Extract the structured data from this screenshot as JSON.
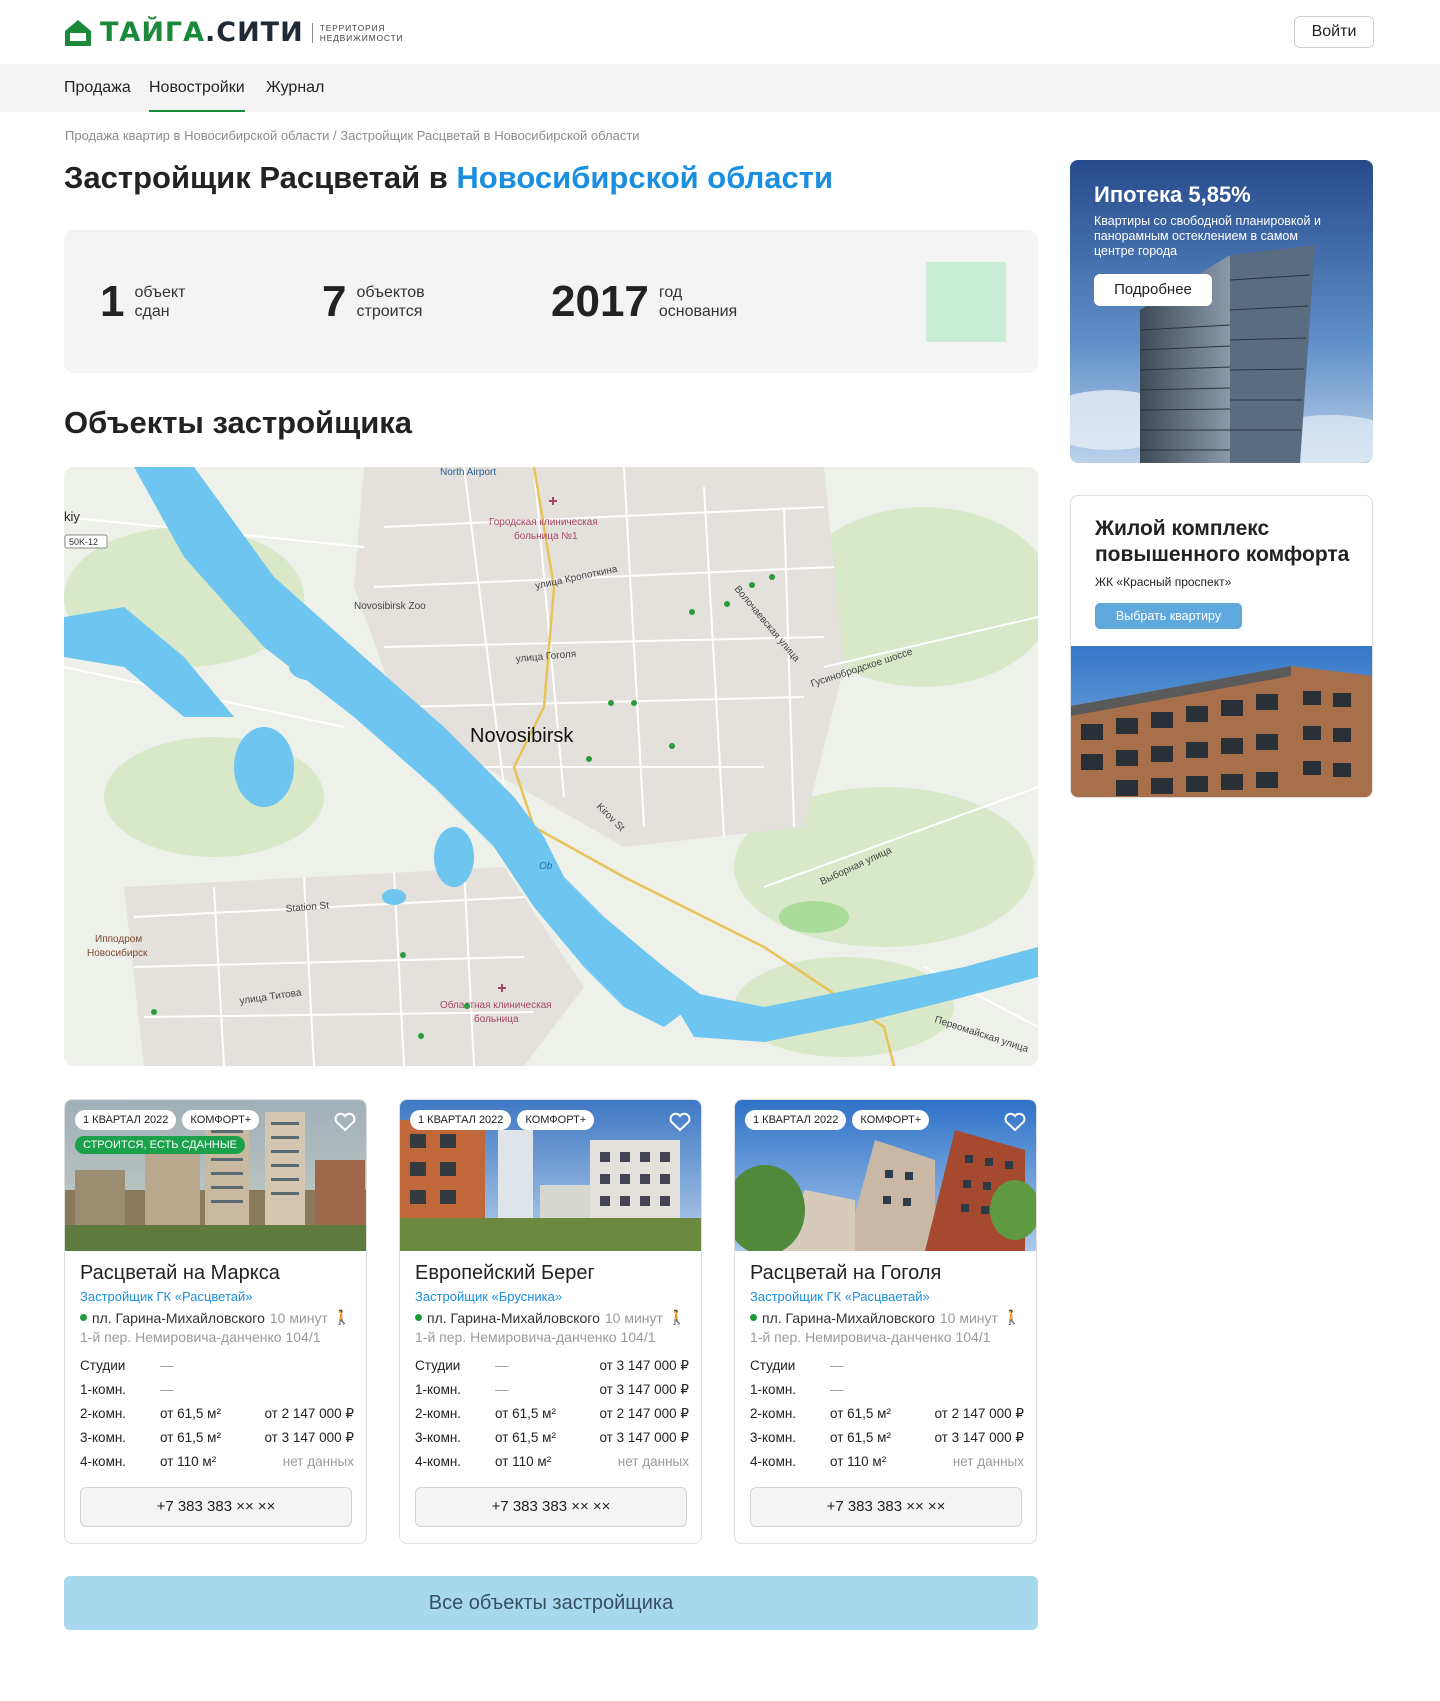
{
  "header": {
    "logo_primary": "ТАЙГА",
    "logo_secondary": ".СИТИ",
    "logo_tag_line1": "ТЕРРИТОРИЯ",
    "logo_tag_line2": "НЕДВИЖИМОСТИ",
    "login_label": "Войти"
  },
  "nav": {
    "items": [
      {
        "label": "Продажа"
      },
      {
        "label": "Новостройки",
        "active": true
      },
      {
        "label": "Журнал"
      }
    ]
  },
  "breadcrumb": "Продажа квартир в Новосибирской области / Застройщик Расцветай в Новосибирской области",
  "title": {
    "main": "Застройщик Расцветай в ",
    "accent": "Новосибирской области"
  },
  "stats": [
    {
      "number": "1",
      "line1": "объект",
      "line2": "сдан"
    },
    {
      "number": "7",
      "line1": "объектов",
      "line2": "строится"
    },
    {
      "number": "2017",
      "line1": "год",
      "line2": "основания"
    }
  ],
  "section_title": "Объекты застройщика",
  "map": {
    "labels": {
      "north_airport": "North Airport",
      "hospital1_line1": "Городская клиническая",
      "hospital1_line2": "больница №1",
      "kropotkina": "улица Кропоткина",
      "zoo": "Novosibirsk Zoo",
      "volochaevskaya": "Волочаевская улица",
      "gogolya": "улица Гоголя",
      "gusinobrodskoe": "Гусинобродское шоссе",
      "city": "Novosibirsk",
      "kirov": "Kirov St",
      "ob": "Ob",
      "vybornaya": "Выборная улица",
      "station": "Station St",
      "hippodrome_line1": "Ипподром",
      "hippodrome_line2": "Новосибирск",
      "titova": "улица Титова",
      "hospital2_line1": "Областная клиническая",
      "hospital2_line2": "больница",
      "pervomayskaya": "Первомайская улица",
      "kiy": "kiy",
      "road_shield": "50K-12"
    }
  },
  "cards": [
    {
      "chips": [
        "1 КВАРТАЛ 2022",
        "КОМФОРТ+"
      ],
      "status": "СТРОИТСЯ, ЕСТЬ СДАННЫЕ",
      "title": "Расцветай на Маркса",
      "developer": "Застройщик ГК «Расцветай»",
      "metro": "пл. Гарина-Михайловского",
      "metro_time": "10 минут",
      "address": "1-й пер. Немировича-данченко 104/1",
      "rows": [
        {
          "type": "Студии",
          "area": "—",
          "price": ""
        },
        {
          "type": "1-комн.",
          "area": "—",
          "price": ""
        },
        {
          "type": "2-комн.",
          "area": "от 61,5 м²",
          "price": "от 2 147 000 ₽"
        },
        {
          "type": "3-комн.",
          "area": "от 61,5 м²",
          "price": "от 3 147 000 ₽"
        },
        {
          "type": "4-комн.",
          "area": "от 110 м²",
          "price": "нет данных"
        }
      ],
      "phone": "+7 383 383 ×× ××"
    },
    {
      "chips": [
        "1 КВАРТАЛ 2022",
        "КОМФОРТ+"
      ],
      "status": "",
      "title": "Европейский Берег",
      "developer": "Застройщик «Брусника»",
      "metro": "пл. Гарина-Михайловского",
      "metro_time": "10 минут",
      "address": "1-й пер. Немировича-данченко 104/1",
      "rows": [
        {
          "type": "Студии",
          "area": "—",
          "price": "от 3 147 000 ₽"
        },
        {
          "type": "1-комн.",
          "area": "—",
          "price": "от 3 147 000 ₽"
        },
        {
          "type": "2-комн.",
          "area": "от 61,5 м²",
          "price": "от 2 147 000 ₽"
        },
        {
          "type": "3-комн.",
          "area": "от 61,5 м²",
          "price": "от 3 147 000 ₽"
        },
        {
          "type": "4-комн.",
          "area": "от 110 м²",
          "price": "нет данных"
        }
      ],
      "phone": "+7 383 383 ×× ××"
    },
    {
      "chips": [
        "1 КВАРТАЛ 2022",
        "КОМФОРТ+"
      ],
      "status": "",
      "title": "Расцветай на Гоголя",
      "developer": "Застройщик ГК «Расцваетай»",
      "metro": "пл. Гарина-Михайловского",
      "metro_time": "10 минут",
      "address": "1-й пер. Немировича-данченко 104/1",
      "rows": [
        {
          "type": "Студии",
          "area": "—",
          "price": ""
        },
        {
          "type": "1-комн.",
          "area": "—",
          "price": ""
        },
        {
          "type": "2-комн.",
          "area": "от 61,5 м²",
          "price": "от 2 147 000 ₽"
        },
        {
          "type": "3-комн.",
          "area": "от 61,5 м²",
          "price": "от 3 147 000 ₽"
        },
        {
          "type": "4-комн.",
          "area": "от 110 м²",
          "price": "нет данных"
        }
      ],
      "phone": "+7 383 383 ×× ××"
    }
  ],
  "all_objects_label": "Все объекты застройщика",
  "ads": {
    "mortgage": {
      "title": "Ипотека 5,85%",
      "text": "Квартиры со свободной планировкой и панорамным остеклением в самом центре города",
      "button": "Подробнее"
    },
    "complex": {
      "title": "Жилой комплекс повышенного комфорта",
      "subtitle": "ЖК «Красный проспект»",
      "button": "Выбрать квартиру"
    }
  },
  "colors": {
    "brand_green": "#1a8a3a",
    "accent_blue": "#1a8fe0",
    "status_green": "#1aa14a",
    "river": "#6ec6f0"
  }
}
